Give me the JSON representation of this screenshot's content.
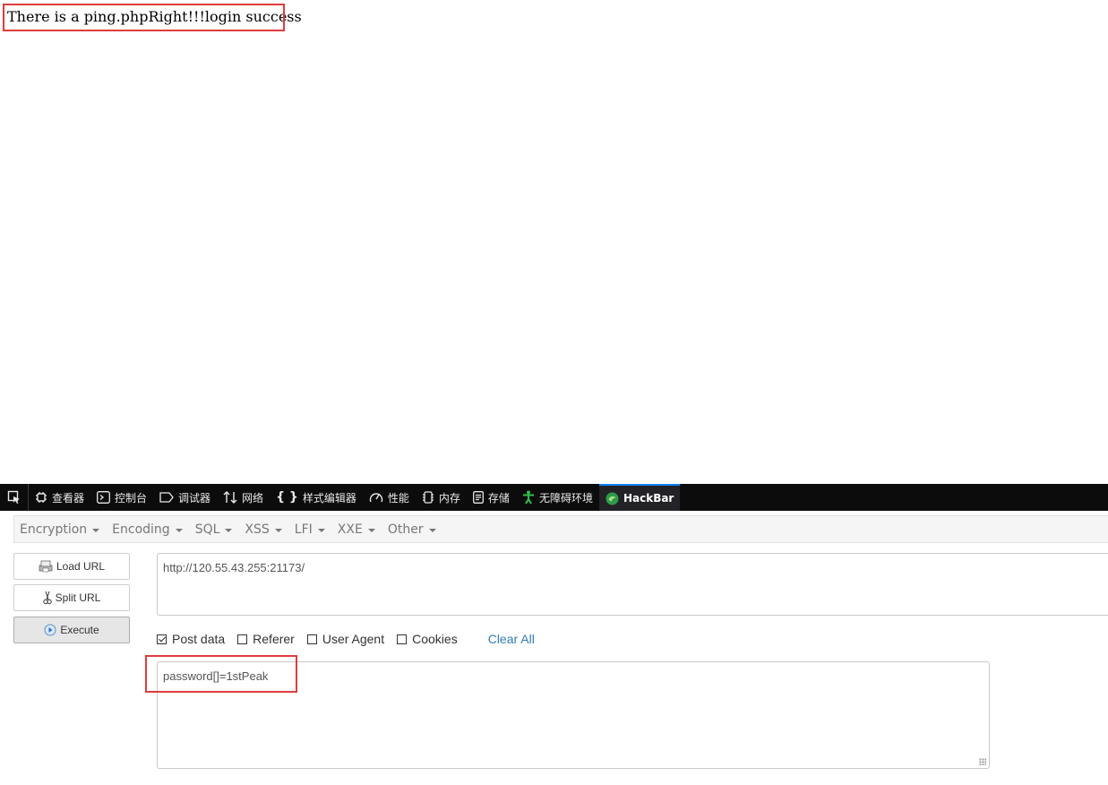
{
  "page": {
    "output_text": "There is a ping.phpRight!!!login success"
  },
  "devtools": {
    "tabs": [
      {
        "label": "查看器",
        "icon": "inspector-icon"
      },
      {
        "label": "控制台",
        "icon": "console-icon"
      },
      {
        "label": "调试器",
        "icon": "debugger-icon"
      },
      {
        "label": "网络",
        "icon": "network-icon"
      },
      {
        "label": "样式编辑器",
        "icon": "style-editor-icon"
      },
      {
        "label": "性能",
        "icon": "performance-icon"
      },
      {
        "label": "内存",
        "icon": "memory-icon"
      },
      {
        "label": "存储",
        "icon": "storage-icon"
      },
      {
        "label": "无障碍环境",
        "icon": "accessibility-icon"
      },
      {
        "label": "HackBar",
        "icon": "hackbar-icon",
        "active": true
      }
    ]
  },
  "hackbar": {
    "menu": [
      "Encryption",
      "Encoding",
      "SQL",
      "XSS",
      "LFI",
      "XXE",
      "Other"
    ],
    "buttons": {
      "load_url": "Load URL",
      "split_url": "Split URL",
      "execute": "Execute"
    },
    "url_value": "http://120.55.43.255:21173/",
    "options": [
      {
        "label": "Post data",
        "checked": true
      },
      {
        "label": "Referer",
        "checked": false
      },
      {
        "label": "User Agent",
        "checked": false
      },
      {
        "label": "Cookies",
        "checked": false
      }
    ],
    "clear_all": "Clear All",
    "post_value": "password[]=1stPeak"
  },
  "colors": {
    "highlight": "#e03c3c",
    "devtools_bg": "#0c0c0d",
    "accent": "#0a84ff",
    "link": "#337ab7"
  }
}
